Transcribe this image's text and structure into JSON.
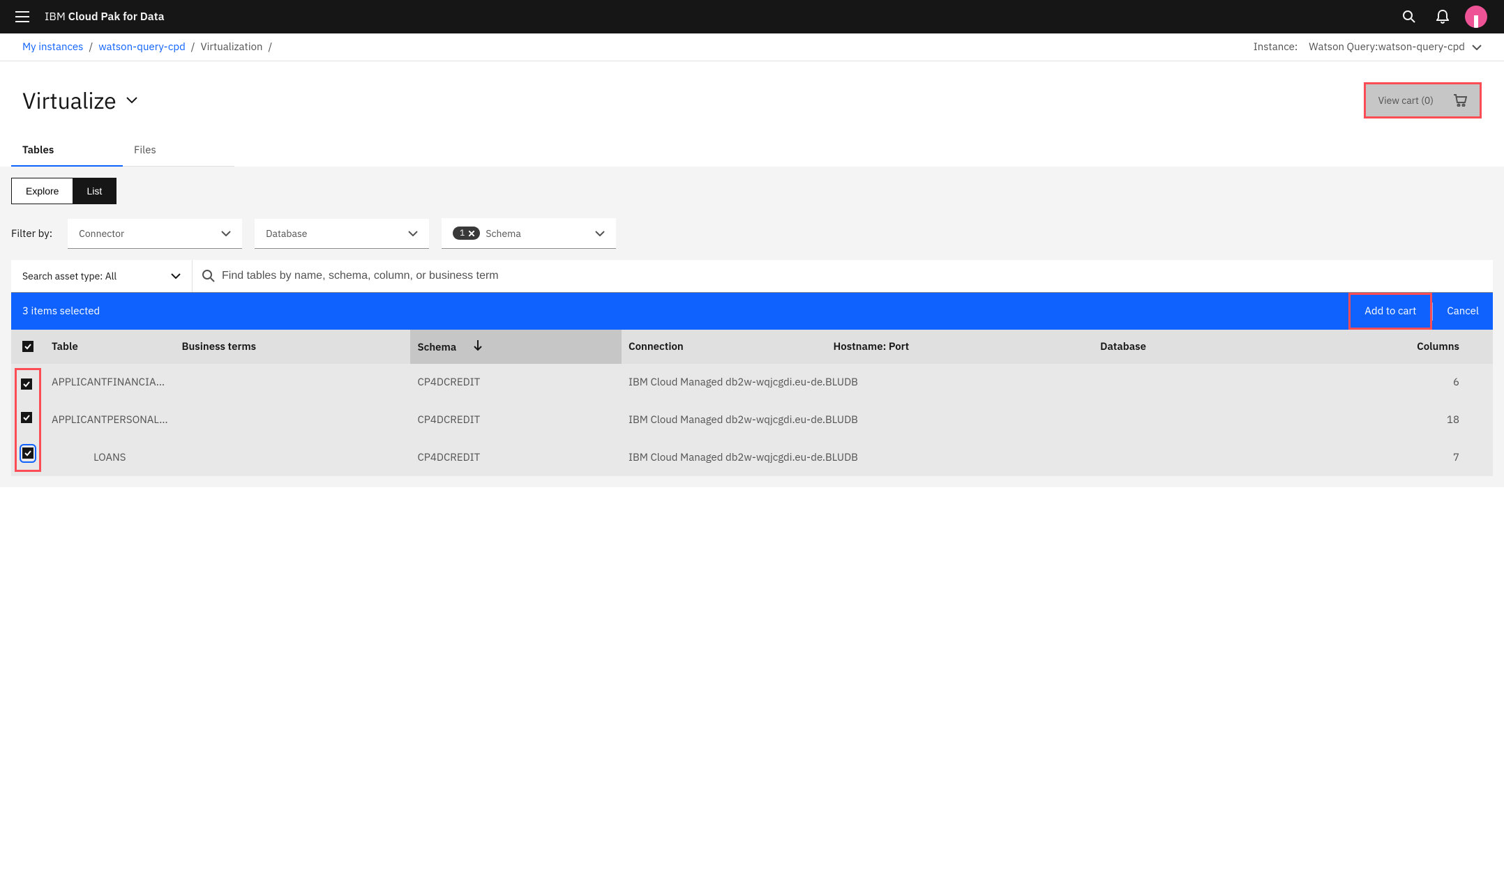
{
  "header": {
    "brand_prefix": "IBM ",
    "brand_bold": "Cloud Pak for Data"
  },
  "subheader": {
    "breadcrumbs": [
      "My instances",
      "watson-query-cpd",
      "Virtualization"
    ],
    "instance_label": "Instance:",
    "instance_value": "Watson Query:watson-query-cpd"
  },
  "title": "Virtualize",
  "view_cart_label": "View cart (0)",
  "tabs": {
    "tables": "Tables",
    "files": "Files"
  },
  "toggle": {
    "explore": "Explore",
    "list": "List"
  },
  "filters": {
    "label": "Filter by:",
    "connector": "Connector",
    "database": "Database",
    "schema": {
      "count": "1",
      "label": "Schema"
    }
  },
  "search": {
    "asset_type_label": "Search asset type: All",
    "placeholder": "Find tables by name, schema, column, or business term"
  },
  "selection": {
    "count_text": "3 items selected",
    "add": "Add to cart",
    "cancel": "Cancel"
  },
  "columns": {
    "table": "Table",
    "terms": "Business terms",
    "schema": "Schema",
    "connection": "Connection",
    "hostport": "Hostname: Port",
    "database": "Database",
    "cols": "Columns"
  },
  "rows": [
    {
      "table": "APPLICANTFINANCIA...",
      "terms": "",
      "schema": "CP4DCREDIT",
      "connection": "IBM Cloud Managed db2w-wqjcgdi.eu-de.BLUDB",
      "hostport": "",
      "database": "",
      "cols": "6"
    },
    {
      "table": "APPLICANTPERSONAL...",
      "terms": "",
      "schema": "CP4DCREDIT",
      "connection": "IBM Cloud Managed db2w-wqjcgdi.eu-de.BLUDB",
      "hostport": "",
      "database": "",
      "cols": "18"
    },
    {
      "table": "LOANS",
      "terms": "",
      "schema": "CP4DCREDIT",
      "connection": "IBM Cloud Managed db2w-wqjcgdi.eu-de.BLUDB",
      "hostport": "",
      "database": "",
      "cols": "7"
    }
  ]
}
